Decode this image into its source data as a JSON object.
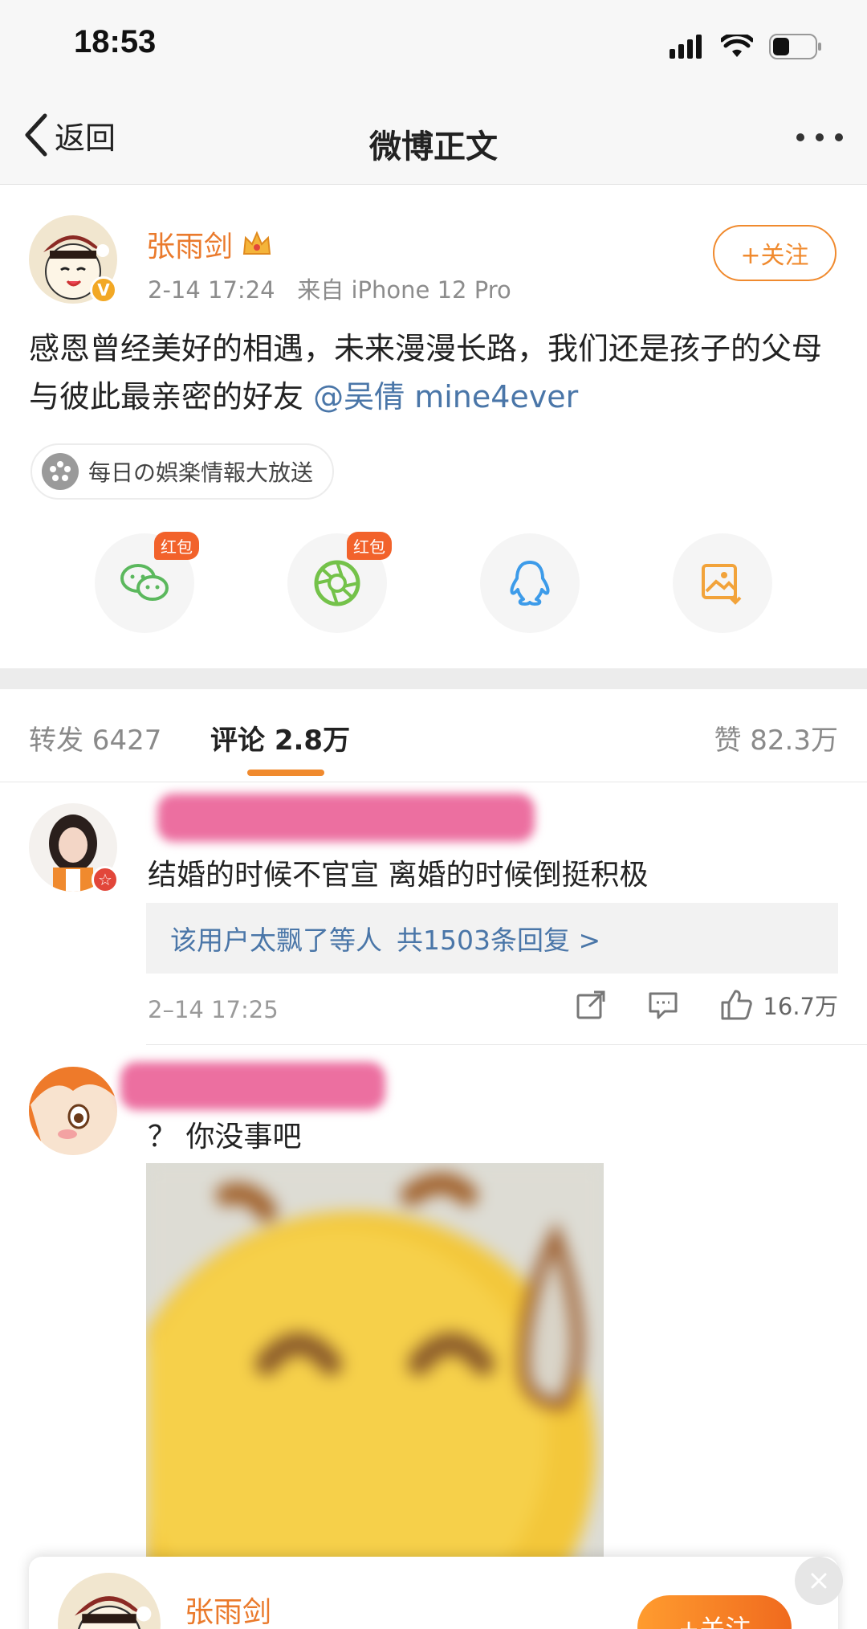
{
  "status_bar": {
    "time": "18:53",
    "icons": [
      "signal-icon",
      "wifi-icon",
      "battery-icon"
    ],
    "battery_level": 0.4
  },
  "nav": {
    "back_label": "返回",
    "title": "微博正文",
    "more_icon": "more-icon"
  },
  "post": {
    "author": "张雨剑",
    "author_badge": "crown-icon",
    "verified_mark": "V",
    "timestamp": "2-14 17:24",
    "source": "来自 iPhone 12 Pro",
    "follow_label": "+关注",
    "text": "感恩曾经美好的相遇，未来漫漫长路，我们还是孩子的父母与彼此最亲密的好友",
    "mention": "@吴倩 mine4ever",
    "topic": "每日の娯楽情報大放送"
  },
  "share": {
    "items": [
      {
        "name": "wechat-share-button",
        "icon": "wechat-icon",
        "badge": "红包",
        "color": "#5bb85d"
      },
      {
        "name": "moments-share-button",
        "icon": "moments-icon",
        "badge": "红包",
        "color": "#74c24a"
      },
      {
        "name": "qq-share-button",
        "icon": "qq-icon",
        "badge": "",
        "color": "#3d9be9"
      },
      {
        "name": "save-image-button",
        "icon": "save-image-icon",
        "badge": "",
        "color": "#f2a33a"
      }
    ]
  },
  "tabs": {
    "repost": "转发 6427",
    "comments": "评论 2.8万",
    "likes": "赞 82.3万"
  },
  "comments": [
    {
      "text": "结婚的时候不官宣 离婚的时候倒挺积极",
      "reply_users": "该用户太飘了等人",
      "reply_count": "共1503条回复 >",
      "time": "2–14 17:25",
      "likes": "16.7万"
    },
    {
      "text": "？ 你没事吧",
      "sticker": "sweat-smile-sticker"
    }
  ],
  "float_card": {
    "name": "张雨剑",
    "follow_label": "+关注"
  },
  "colors": {
    "accent": "#f08a2e",
    "link": "#4a76a8",
    "username": "#ea7a2c"
  }
}
